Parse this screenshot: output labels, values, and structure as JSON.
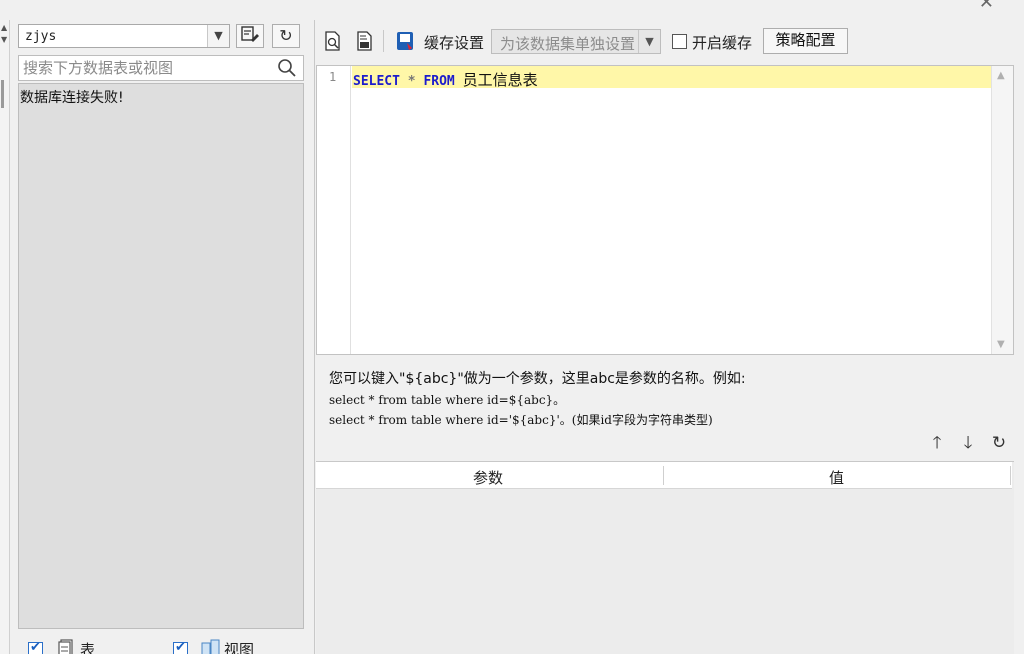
{
  "left": {
    "datasource": "zjys",
    "search_placeholder": "搜索下方数据表或视图",
    "tree_message": "数据库连接失败!",
    "filters": [
      {
        "label": "表",
        "checked": true
      },
      {
        "label": "视图",
        "checked": true
      }
    ]
  },
  "toolbar": {
    "cache_label": "缓存设置",
    "cache_option": "为该数据集单独设置",
    "enable_cache_label": "开启缓存",
    "policy_button": "策略配置"
  },
  "editor": {
    "line_number": "1",
    "keyword_select": "SELECT",
    "operator_star": "*",
    "keyword_from": "FROM",
    "table_name": "员工信息表"
  },
  "hint": {
    "line1": "您可以键入\"${abc}\"做为一个参数，这里abc是参数的名称。例如:",
    "line2": "select * from table where id=${abc}。",
    "line3": "select * from table where id='${abc}'。(如果id字段为字符串类型)"
  },
  "param_table": {
    "columns": [
      "参数",
      "值"
    ]
  },
  "colors": {
    "keyword": "#1c1ccc",
    "line_highlight": "#fff7a8",
    "checkbox_accent": "#1a5fbf"
  }
}
